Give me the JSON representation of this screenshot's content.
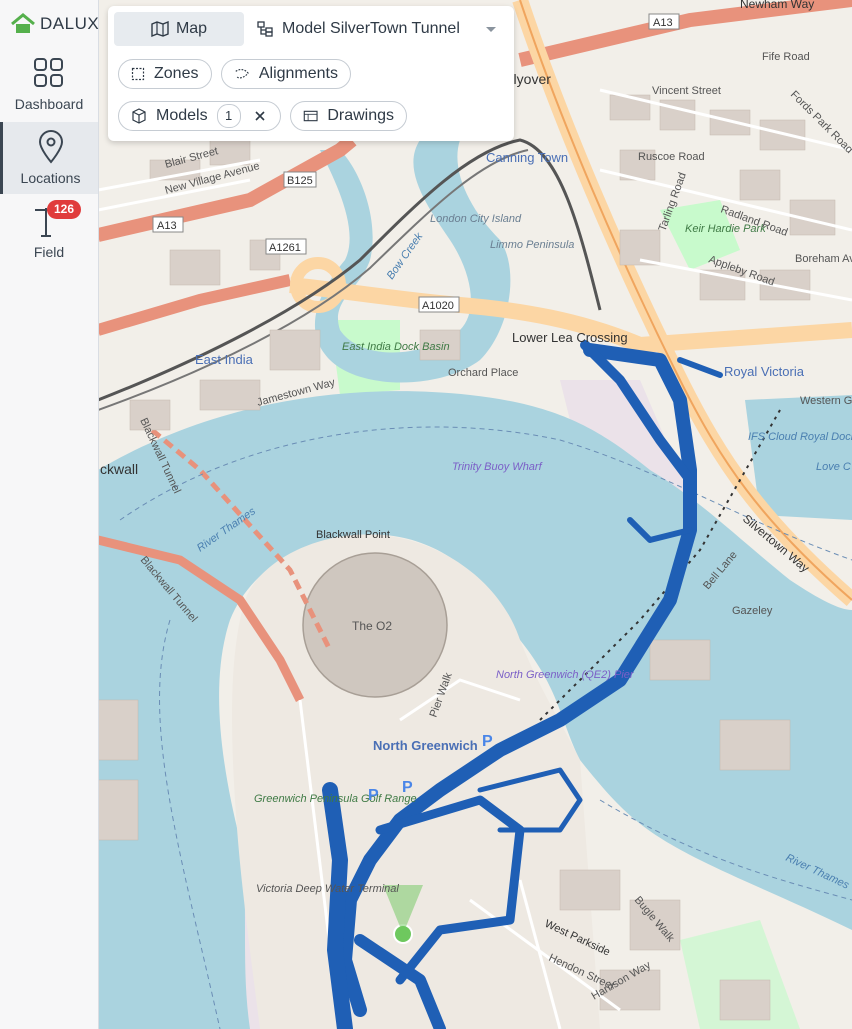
{
  "app": {
    "logo_text": "DALUX"
  },
  "sidebar": {
    "items": [
      {
        "label": "Dashboard",
        "icon": "dashboard-grid-icon",
        "active": false
      },
      {
        "label": "Locations",
        "icon": "location-pin-icon",
        "active": true
      },
      {
        "label": "Field",
        "icon": "crane-icon",
        "active": false,
        "badge": "126"
      }
    ]
  },
  "toolbar": {
    "map_tab": "Map",
    "model_tab": "Model SilverTown Tunnel",
    "chips": {
      "zones": "Zones",
      "alignments": "Alignments",
      "models": "Models",
      "models_count": "1",
      "drawings": "Drawings"
    }
  },
  "map": {
    "labels": {
      "newham_way": "Newham Way",
      "flyover": "Flyover",
      "a13_top": "A13",
      "fife_road": "Fife Road",
      "vincent_street": "Vincent Street",
      "fords_park_road": "Fords Park Road",
      "blair_street": "Blair Street",
      "new_village_avenue": "New Village Avenue",
      "b125": "B125",
      "a13_left": "A13",
      "canning_town": "Canning Town",
      "london_city_island": "London City Island",
      "limmo_peninsula": "Limmo Peninsula",
      "ruscoe_road": "Ruscoe Road",
      "radland_road": "Radland Road",
      "keir_hardie_park": "Keir Hardie Park",
      "appleby_road": "Appleby Road",
      "tarling_road": "Tarling Road",
      "boreham_avenue": "Boreham Av",
      "a1261": "A1261",
      "bow_creek": "Bow Creek",
      "a1020": "A1020",
      "lower_lea_crossing": "Lower Lea Crossing",
      "east_india": "East India",
      "east_india_dock_basin": "East India Dock Basin",
      "orchard_place": "Orchard Place",
      "jamestown_way": "Jamestown Way",
      "blackwall_tunnel": "Blackwall Tunnel",
      "blackwall": "ckwall",
      "trinity_buoy_wharf": "Trinity Buoy Wharf",
      "royal_victoria": "Royal Victoria",
      "western_gateway": "Western Gat",
      "ifs_cloud_royal_docks": "IFS Cloud Royal Docks",
      "love_lane": "Love C",
      "silvertown_way": "Silvertown Way",
      "bell_lane": "Bell Lane",
      "gazeley": "Gazeley",
      "river_thames_top": "River Thames",
      "river_thames_right": "River Thames",
      "blackwall_point": "Blackwall Point",
      "the_o2": "The O2",
      "blackwall_tunnel_left": "Blackwall Tunnel",
      "north_greenwich_pier": "North Greenwich (QE2) Pier",
      "north_greenwich": "North Greenwich",
      "pier_walk": "Pier Walk",
      "greenwich_peninsula_golf_range": "Greenwich Peninsula Golf Range",
      "victoria_deep_water_terminal": "Victoria Deep Water Terminal",
      "west_parkside": "West Parkside",
      "hendon_street": "Hendon Street",
      "harrison_way": "Harrison Way",
      "bugle_walk": "Bugle Walk"
    },
    "colors": {
      "water": "#aad3df",
      "land": "#f2efe9",
      "park": "#c8facc",
      "motorway": "#e8927c",
      "trunk": "#fcd6a4",
      "model_overlay": "#1f5fb5",
      "industrial": "#e8dee8"
    }
  }
}
